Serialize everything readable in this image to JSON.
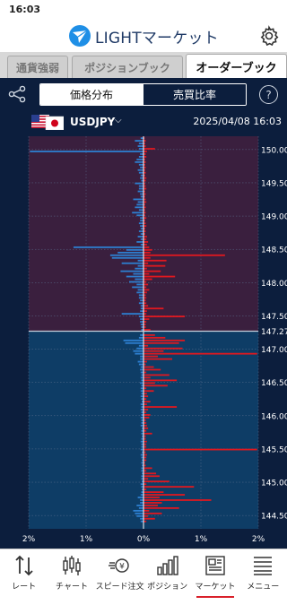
{
  "status": {
    "time": "16:03"
  },
  "header": {
    "title": "LIGHTマーケット"
  },
  "tabs": [
    {
      "label": "通貨強弱",
      "active": false
    },
    {
      "label": "ポジションブック",
      "active": false
    },
    {
      "label": "オーダーブック",
      "active": true
    }
  ],
  "subtabs": [
    {
      "label": "価格分布",
      "active": true
    },
    {
      "label": "売買比率",
      "active": false
    }
  ],
  "help": "?",
  "pair": {
    "symbol": "USDJPY",
    "caret": "⌵",
    "datetime": "2025/04/08 16:03"
  },
  "colors": {
    "bg": "#0c1e3d",
    "sell_zone": "#3a1f3e",
    "buy_zone": "#0e3d66",
    "buy_bar": "#2d7fd0",
    "sell_bar": "#e0181f",
    "current_line": "#c8d0dc"
  },
  "chart_data": {
    "type": "bar",
    "orientation": "horizontal",
    "current_price": 147.27,
    "ylim": [
      144.3,
      150.2
    ],
    "xlim_percent": [
      -2,
      2
    ],
    "y_ticks": [
      "150.00",
      "149.50",
      "149.00",
      "148.50",
      "148.00",
      "147.50",
      "147.27",
      "147.00",
      "146.50",
      "146.00",
      "145.50",
      "145.00",
      "144.50"
    ],
    "x_ticks": [
      "2%",
      "1%",
      "0%",
      "1%",
      "2%"
    ],
    "series": [
      {
        "side": "left",
        "prices": [
          150.17,
          150.13,
          150.09,
          150.05,
          150.01,
          149.97,
          149.93,
          149.89,
          149.85,
          149.81,
          149.77,
          149.73,
          149.69,
          149.65,
          149.61,
          149.57,
          149.53,
          149.49,
          149.45,
          149.41,
          149.37,
          149.33,
          149.29,
          149.25,
          149.21,
          149.17,
          149.13,
          149.09,
          149.05,
          149.01,
          148.97,
          148.93,
          148.89,
          148.85,
          148.81,
          148.77,
          148.73,
          148.69,
          148.65,
          148.61,
          148.57,
          148.53,
          148.49,
          148.45,
          148.41,
          148.37,
          148.33,
          148.29,
          148.25,
          148.21,
          148.17,
          148.13,
          148.09,
          148.05,
          148.01,
          147.97,
          147.93,
          147.89,
          147.85,
          147.81,
          147.77,
          147.73,
          147.69,
          147.65,
          147.61,
          147.57,
          147.53,
          147.49,
          147.45,
          147.41,
          147.37,
          147.33,
          147.29,
          147.21,
          147.17,
          147.13,
          147.09,
          147.05,
          147.01,
          146.97,
          146.93,
          146.89,
          146.85,
          146.81,
          146.77,
          146.73,
          146.69,
          146.65,
          146.61,
          146.57,
          146.53,
          146.49,
          146.45,
          146.41,
          146.37,
          146.33,
          146.29,
          146.25,
          146.21,
          146.17,
          146.13,
          146.09,
          146.05,
          146.01,
          145.97,
          145.93,
          145.89,
          145.85,
          145.81,
          145.77,
          145.73,
          145.69,
          145.65,
          145.61,
          145.57,
          145.53,
          145.49,
          145.45,
          145.41,
          145.37,
          145.33,
          145.29,
          145.25,
          145.21,
          145.17,
          145.13,
          145.09,
          145.05,
          145.01,
          144.97,
          144.93,
          144.89,
          144.85,
          144.81,
          144.77,
          144.73,
          144.69,
          144.65,
          144.61,
          144.57,
          144.53,
          144.49,
          144.45,
          144.41
        ],
        "values": [
          0.05,
          0.15,
          0.08,
          0.1,
          0.08,
          1.98,
          0.06,
          0.08,
          0.12,
          0.15,
          0.08,
          0.06,
          0.1,
          0.08,
          0.05,
          0.06,
          0.04,
          0.15,
          0.08,
          0.08,
          0.1,
          0.06,
          0.05,
          0.18,
          0.1,
          0.12,
          0.15,
          0.08,
          0.2,
          0.12,
          0.06,
          0.06,
          0.08,
          0.06,
          0.05,
          0.08,
          0.05,
          0.1,
          0.05,
          0.12,
          0.05,
          1.22,
          0.3,
          0.45,
          0.58,
          0.55,
          0.1,
          0.38,
          0.1,
          0.15,
          0.4,
          0.18,
          0.3,
          0.15,
          0.25,
          0.12,
          0.2,
          0.1,
          0.12,
          0.08,
          0.08,
          0.06,
          0.08,
          0.05,
          0.05,
          0.06,
          0.38,
          0.08,
          0.06,
          0.06,
          0.05,
          0.04,
          0.04,
          0.06,
          0.08,
          0.35,
          0.32,
          0.08,
          0.12,
          0.18,
          0.15,
          0.06,
          0.06,
          0.1,
          0.08,
          0.05,
          0.06,
          0.05,
          0.04,
          0.05,
          0.04,
          0.06,
          0.04,
          0.05,
          0.05,
          0.04,
          0.05,
          0.04,
          0.03,
          0.05,
          0.04,
          0.05,
          0.04,
          0.04,
          0.05,
          0.04,
          0.04,
          0.05,
          0.03,
          0.04,
          0.04,
          0.03,
          0.04,
          0.05,
          0.04,
          0.04,
          0.05,
          0.03,
          0.05,
          0.04,
          0.03,
          0.04,
          0.03,
          0.04,
          0.04,
          0.03,
          0.04,
          0.04,
          0.03,
          0.05,
          0.04,
          0.03,
          0.04,
          0.05,
          0.1,
          0.06,
          0.06,
          0.12,
          0.08,
          0.18,
          0.15,
          0.12,
          0.06,
          0.05
        ]
      },
      {
        "side": "right",
        "prices": [
          150.17,
          150.13,
          150.09,
          150.05,
          150.01,
          149.97,
          149.93,
          149.89,
          149.85,
          149.81,
          149.77,
          149.73,
          149.69,
          149.65,
          149.61,
          149.57,
          149.53,
          149.49,
          149.45,
          149.41,
          149.37,
          149.33,
          149.29,
          149.25,
          149.21,
          149.17,
          149.13,
          149.09,
          149.05,
          149.01,
          148.97,
          148.93,
          148.89,
          148.85,
          148.81,
          148.77,
          148.73,
          148.69,
          148.65,
          148.61,
          148.57,
          148.53,
          148.49,
          148.45,
          148.41,
          148.37,
          148.33,
          148.29,
          148.25,
          148.21,
          148.17,
          148.13,
          148.09,
          148.05,
          148.01,
          147.97,
          147.93,
          147.89,
          147.85,
          147.81,
          147.77,
          147.73,
          147.69,
          147.65,
          147.61,
          147.57,
          147.53,
          147.49,
          147.45,
          147.41,
          147.37,
          147.33,
          147.29,
          147.21,
          147.17,
          147.13,
          147.09,
          147.05,
          147.01,
          146.97,
          146.93,
          146.89,
          146.85,
          146.81,
          146.77,
          146.73,
          146.69,
          146.65,
          146.61,
          146.57,
          146.53,
          146.49,
          146.45,
          146.41,
          146.37,
          146.33,
          146.29,
          146.25,
          146.21,
          146.17,
          146.13,
          146.09,
          146.05,
          146.01,
          145.97,
          145.93,
          145.89,
          145.85,
          145.81,
          145.77,
          145.73,
          145.69,
          145.65,
          145.61,
          145.57,
          145.53,
          145.49,
          145.45,
          145.41,
          145.37,
          145.33,
          145.29,
          145.25,
          145.21,
          145.17,
          145.13,
          145.09,
          145.05,
          145.01,
          144.97,
          144.93,
          144.89,
          144.85,
          144.81,
          144.77,
          144.73,
          144.69,
          144.65,
          144.61,
          144.57,
          144.53,
          144.49,
          144.45,
          144.41
        ],
        "values": [
          0.02,
          0.04,
          0.03,
          0.04,
          0.2,
          0.06,
          0.04,
          0.05,
          0.03,
          0.04,
          0.03,
          0.04,
          0.03,
          0.04,
          0.03,
          0.05,
          0.04,
          0.03,
          0.04,
          0.05,
          0.03,
          0.04,
          0.03,
          0.04,
          0.05,
          0.03,
          0.04,
          0.03,
          0.04,
          0.03,
          0.05,
          0.03,
          0.04,
          0.05,
          0.03,
          0.04,
          0.03,
          0.06,
          0.05,
          0.08,
          0.06,
          0.1,
          0.15,
          0.12,
          1.42,
          0.12,
          0.4,
          0.08,
          0.38,
          0.06,
          0.3,
          0.1,
          0.55,
          0.15,
          0.05,
          0.08,
          0.05,
          0.1,
          0.06,
          0.04,
          0.05,
          0.04,
          0.05,
          0.08,
          0.35,
          0.06,
          0.05,
          0.72,
          0.1,
          0.05,
          0.04,
          0.04,
          0.12,
          0.2,
          0.38,
          0.72,
          0.62,
          0.08,
          0.68,
          0.35,
          1.98,
          0.25,
          0.5,
          0.06,
          0.04,
          0.18,
          0.3,
          0.05,
          0.45,
          0.12,
          0.58,
          0.2,
          0.42,
          0.05,
          0.18,
          0.06,
          0.08,
          0.05,
          0.12,
          0.06,
          0.58,
          0.08,
          0.05,
          0.12,
          0.1,
          0.04,
          0.05,
          0.06,
          0.08,
          0.05,
          0.15,
          0.04,
          0.04,
          0.06,
          0.05,
          0.05,
          1.98,
          0.04,
          0.06,
          0.05,
          0.05,
          0.03,
          0.04,
          0.15,
          0.05,
          0.22,
          0.28,
          0.08,
          0.45,
          0.05,
          0.88,
          0.05,
          0.35,
          0.72,
          0.28,
          1.18,
          0.32,
          0.25,
          0.62,
          0.1,
          0.32,
          0.08,
          0.2,
          0.05,
          0.04,
          0.03
        ]
      }
    ]
  },
  "nav": [
    {
      "label": "レート",
      "icon": "rate-arrows-icon",
      "active": false
    },
    {
      "label": "チャート",
      "icon": "candlestick-icon",
      "active": false
    },
    {
      "label": "スピード注文",
      "icon": "speed-order-icon",
      "active": false
    },
    {
      "label": "ポジション",
      "icon": "position-bars-icon",
      "active": false
    },
    {
      "label": "マーケット",
      "icon": "market-news-icon",
      "active": true
    },
    {
      "label": "メニュー",
      "icon": "menu-icon",
      "active": false
    }
  ]
}
